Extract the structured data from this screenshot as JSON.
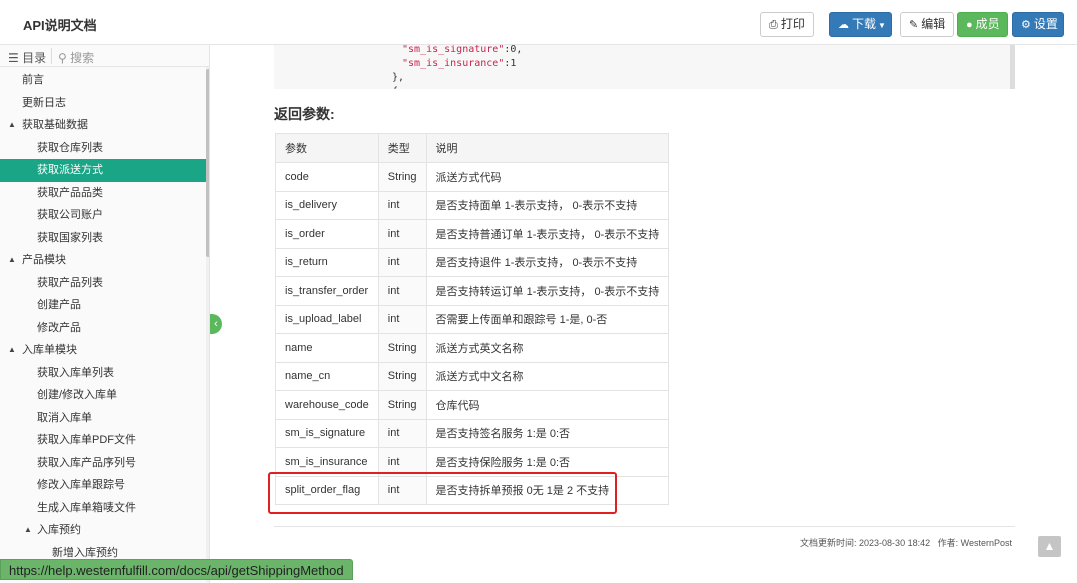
{
  "header": {
    "title": "API说明文档",
    "buttons": {
      "print": "打印",
      "download": "下载",
      "edit": "编辑",
      "member": "成员",
      "settings": "设置"
    }
  },
  "sidebar": {
    "tab_toc": "目录",
    "tab_search": "搜索",
    "items": [
      {
        "label": "前言",
        "level": 0,
        "caret": ""
      },
      {
        "label": "更新日志",
        "level": 0,
        "caret": ""
      },
      {
        "label": "获取基础数据",
        "level": 0,
        "caret": "▲"
      },
      {
        "label": "获取仓库列表",
        "level": 1,
        "caret": ""
      },
      {
        "label": "获取派送方式",
        "level": 1,
        "caret": "",
        "active": true
      },
      {
        "label": "获取产品品类",
        "level": 1,
        "caret": ""
      },
      {
        "label": "获取公司账户",
        "level": 1,
        "caret": ""
      },
      {
        "label": "获取国家列表",
        "level": 1,
        "caret": ""
      },
      {
        "label": "产品模块",
        "level": 0,
        "caret": "▲"
      },
      {
        "label": "获取产品列表",
        "level": 1,
        "caret": ""
      },
      {
        "label": "创建产品",
        "level": 1,
        "caret": ""
      },
      {
        "label": "修改产品",
        "level": 1,
        "caret": ""
      },
      {
        "label": "入库单模块",
        "level": 0,
        "caret": "▲"
      },
      {
        "label": "获取入库单列表",
        "level": 1,
        "caret": ""
      },
      {
        "label": "创建/修改入库单",
        "level": 1,
        "caret": ""
      },
      {
        "label": "取消入库单",
        "level": 1,
        "caret": ""
      },
      {
        "label": "获取入库单PDF文件",
        "level": 1,
        "caret": ""
      },
      {
        "label": "获取入库产品序列号",
        "level": 1,
        "caret": ""
      },
      {
        "label": "修改入库单跟踪号",
        "level": 1,
        "caret": ""
      },
      {
        "label": "生成入库单箱唛文件",
        "level": 1,
        "caret": ""
      },
      {
        "label": "入库预约",
        "level": 1,
        "caret": "▲"
      },
      {
        "label": "新增入库预约",
        "level": 2,
        "caret": ""
      }
    ]
  },
  "code": {
    "lines": [
      {
        "key": "\"sm_is_signature\"",
        "rest": ":0,"
      },
      {
        "key": "\"sm_is_insurance\"",
        "rest": ":1"
      },
      {
        "key": "",
        "rest": "},"
      },
      {
        "key": "",
        "rest": "{"
      }
    ]
  },
  "section_title": "返回参数:",
  "table": {
    "headers": [
      "参数",
      "类型",
      "说明"
    ],
    "rows": [
      [
        "code",
        "String",
        "派送方式代码"
      ],
      [
        "is_delivery",
        "int",
        "是否支持面单 1-表示支持， 0-表示不支持"
      ],
      [
        "is_order",
        "int",
        "是否支持普通订单 1-表示支持， 0-表示不支持"
      ],
      [
        "is_return",
        "int",
        "是否支持退件 1-表示支持， 0-表示不支持"
      ],
      [
        "is_transfer_order",
        "int",
        "是否支持转运订单 1-表示支持， 0-表示不支持"
      ],
      [
        "is_upload_label",
        "int",
        "否需要上传面单和跟踪号 1-是, 0-否"
      ],
      [
        "name",
        "String",
        "派送方式英文名称"
      ],
      [
        "name_cn",
        "String",
        "派送方式中文名称"
      ],
      [
        "warehouse_code",
        "String",
        "仓库代码"
      ],
      [
        "sm_is_signature",
        "int",
        "是否支持签名服务 1:是 0:否"
      ],
      [
        "sm_is_insurance",
        "int",
        "是否支持保险服务 1:是 0:否"
      ],
      [
        "split_order_flag",
        "int",
        "是否支持拆单预报 0无 1是 2 不支持"
      ]
    ]
  },
  "footer": {
    "updated_label": "文档更新时间:",
    "updated_value": "2023-08-30 18:42",
    "author_label": "作者:",
    "author_value": "WesternPost"
  },
  "status_url": "https://help.westernfulfill.com/docs/api/getShippingMethod",
  "colors": {
    "active_nav": "#1aa587",
    "primary": "#337ab7",
    "success": "#5cb85c",
    "highlight": "#e02020"
  }
}
